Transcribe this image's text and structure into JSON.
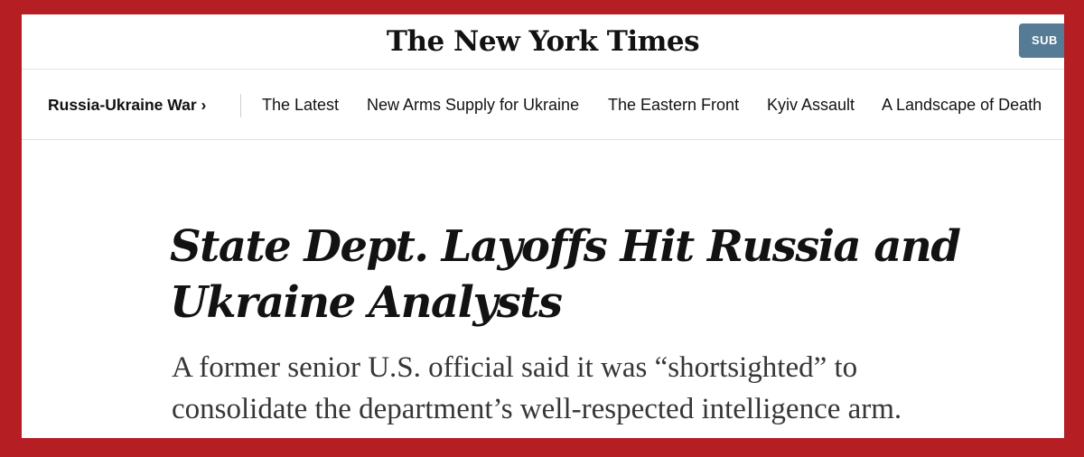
{
  "header": {
    "logo_text": "The New York Times",
    "subscribe_label": "SUB"
  },
  "subnav": {
    "section_label": "Russia-Ukraine War ›",
    "items": [
      {
        "label": "The Latest"
      },
      {
        "label": "New Arms Supply for Ukraine"
      },
      {
        "label": "The Eastern Front"
      },
      {
        "label": "Kyiv Assault"
      },
      {
        "label": "A Landscape of Death"
      }
    ]
  },
  "article": {
    "headline_line1": "State Dept. Layoffs Hit Russia and",
    "headline_line2": "Ukraine Analysts",
    "summary_line1": "A former senior U.S. official said it was “shortsighted” to",
    "summary_line2": "consolidate the department’s well-respected intelligence arm."
  },
  "colors": {
    "frame_border": "#b51f24",
    "subscribe_button": "#567b95",
    "text": "#121212"
  }
}
